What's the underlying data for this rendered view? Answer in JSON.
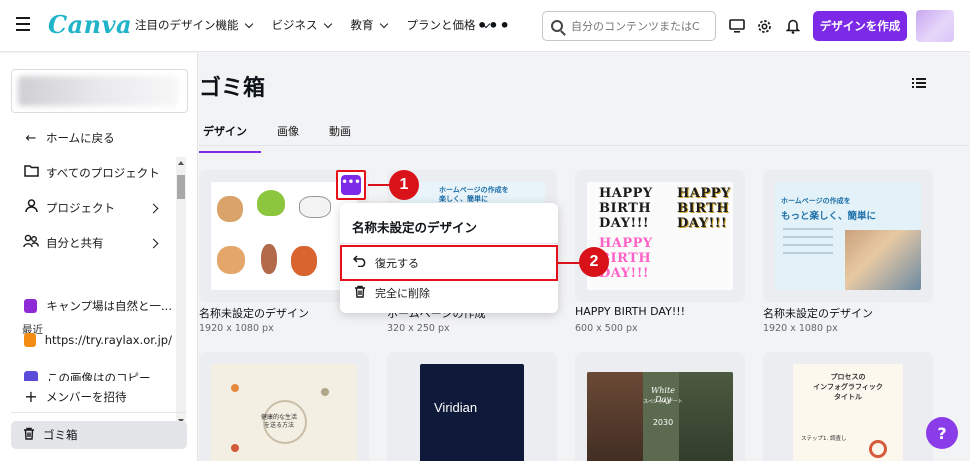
{
  "header": {
    "logo": "Canva",
    "nav": [
      "注目のデザイン機能",
      "ビジネス",
      "教育",
      "プランと価格"
    ],
    "more": "•••",
    "search_placeholder": "自分のコンテンツまたはC",
    "create_button": "デザインを作成"
  },
  "sidebar": {
    "back_home": "ホームに戻る",
    "all_projects": "すべてのプロジェクト",
    "projects": "プロジェクト",
    "shared": "自分と共有",
    "recent_label": "最近",
    "recent": [
      {
        "label": "キャンプ場は自然と一...",
        "color": "#8e2bd6"
      },
      {
        "label": "https://try.raylax.or.jp/",
        "color": "#f28c13"
      },
      {
        "label": "この画像はのコピー",
        "color": "#5a4bd8"
      }
    ],
    "invite": "メンバーを招待",
    "trash": "ゴミ箱"
  },
  "main": {
    "title": "ゴミ箱",
    "tabs": [
      "デザイン",
      "画像",
      "動画"
    ],
    "active_tab": 0,
    "cards": [
      {
        "title": "名称未設定のデザイン",
        "size": "1920 x 1080 px"
      },
      {
        "title": "ホームページの作成",
        "size": "320 x 250 px"
      },
      {
        "title": "HAPPY BIRTH DAY!!!",
        "size": "600 x 500 px"
      },
      {
        "title": "名称未設定のデザイン",
        "size": "1920 x 1080 px"
      }
    ],
    "thumb_texts": {
      "hp_small": "ホームページの作成を\n楽しく、簡単に",
      "hp_large_line1": "ホームページの作成を",
      "hp_large_line2": "もっと楽しく、簡単に",
      "bday_1": "HAPPY\nBIRTH\nDAY!!!",
      "bday_2": "HAPPY\nBIRTH\nDAY!!!",
      "bday_3": "HAPPY\nBIRTH\nDAY!!!",
      "health": "健康的な生活\nを送る方法",
      "viridian": "Viridian",
      "white_day_title": "White Day",
      "white_day_sub": "スペシャルデート",
      "white_day_year": "2030",
      "process": "プロセスの\nインフォグラフィック\nタイトル",
      "process_step": "ステップ1. 調査し"
    }
  },
  "menu": {
    "title": "名称未設定のデザイン",
    "restore": "復元する",
    "delete": "完全に削除"
  },
  "callouts": [
    "1",
    "2"
  ],
  "help": "?"
}
